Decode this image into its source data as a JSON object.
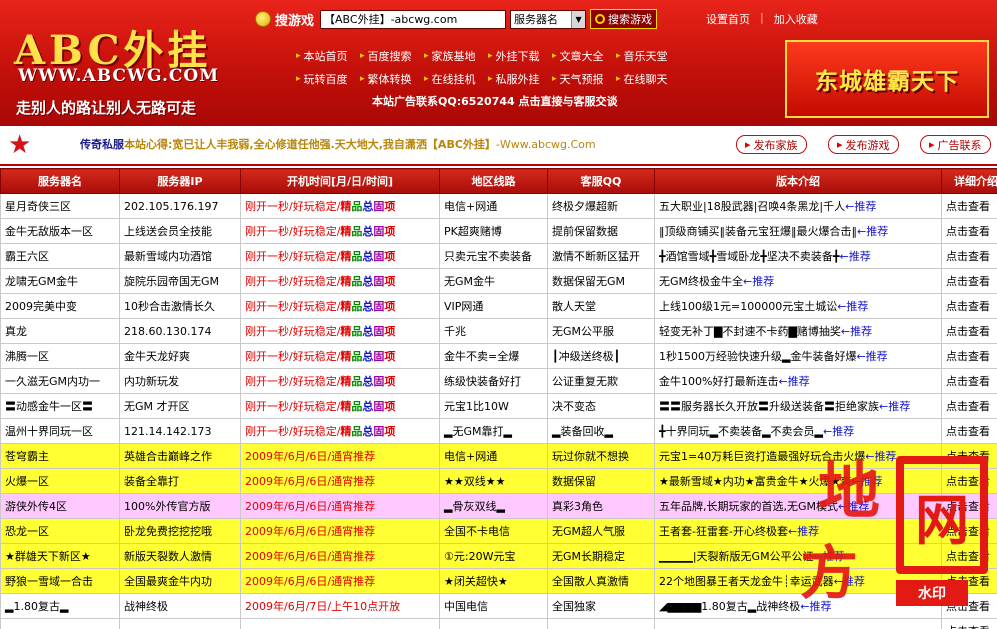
{
  "header": {
    "logo_title": "ABC外挂",
    "logo_url": "WWW.ABCWG.COM",
    "slogan": "走别人的路让别人无路可走",
    "search_label": "搜游戏",
    "search_value": "【ABC外挂】-abcwg.com",
    "select_value": "服务器名",
    "search_button": "搜索游戏",
    "top_links": [
      "设置首页",
      "加入收藏"
    ],
    "nav_rows": [
      [
        "本站首页",
        "百度搜索",
        "家族基地",
        "外挂下载",
        "文章大全",
        "音乐天堂"
      ],
      [
        "玩转百度",
        "繁体转换",
        "在线挂机",
        "私服外挂",
        "天气预报",
        "在线聊天"
      ]
    ],
    "ad_contact": "本站广告联系QQ:6520744 点击直接与客服交谈",
    "banner_text": "东城雄霸天下"
  },
  "announce": {
    "prefix": "传奇私服",
    "bold_text": "本站心得:宽已让人丰我弱,全心修道任他强.天大地大,我自潇洒【ABC外挂】",
    "url_text": "-Www.abcwg.Com",
    "buttons": [
      "发布家族",
      "发布游戏",
      "广告联系"
    ]
  },
  "columns": [
    "服务器名",
    "服务器IP",
    "开机时间[月/日/时间]",
    "地区线路",
    "客服QQ",
    "版本介绍",
    "详细介绍"
  ],
  "rows": [
    {
      "style": "",
      "name": "星月奇侠三区",
      "ip": "202.105.176.197",
      "time": "刚开一秒/好玩稳定/",
      "hot": true,
      "line": "电信+网通",
      "qq": "终极夕爆超新",
      "intro": "五大职业|18股武器|召唤4条黑龙|千人",
      "rec": "推荐",
      "detail": "点击查看"
    },
    {
      "style": "",
      "name": "金牛无敌版本一区",
      "ip": "上线送会员全技能",
      "time": "刚开一秒/好玩稳定/",
      "hot": true,
      "line": "PK超爽赌博",
      "qq": "提前保留数据",
      "intro": "‖顶级商铺买‖装备元宝狂爆‖最火爆合击‖",
      "rec": "推荐",
      "detail": "点击查看"
    },
    {
      "style": "",
      "name": "霸王六区",
      "ip": "最新雪域内功酒馆",
      "time": "刚开一秒/好玩稳定/",
      "hot": true,
      "line": "只卖元宝不卖装备",
      "qq": "激情不断新区猛开",
      "intro": "╋酒馆雪域╋雪域卧龙╋坚决不卖装备╋",
      "rec": "推荐",
      "detail": "点击查看"
    },
    {
      "style": "",
      "name": "龙啸无GM金牛",
      "ip": "旋院乐园帝国无GM",
      "time": "刚开一秒/好玩稳定/",
      "hot": true,
      "line": "无GM金牛",
      "qq": "数据保留无GM",
      "intro": "无GM终极金牛全",
      "rec": "推荐",
      "detail": "点击查看"
    },
    {
      "style": "",
      "name": "2009完美中变",
      "ip": "10秒合击激情长久",
      "time": "刚开一秒/好玩稳定/",
      "hot": true,
      "line": "VIP网通",
      "qq": "散人天堂",
      "intro": "上线100级1元=100000元宝土城讼",
      "rec": "推荐",
      "detail": "点击查看"
    },
    {
      "style": "",
      "name": "真龙",
      "ip": "218.60.130.174",
      "time": "刚开一秒/好玩稳定/",
      "hot": true,
      "line": "千兆",
      "qq": "无GM公平服",
      "intro": "轻变无补丁▇不封速不卡药▇赌博抽奖",
      "rec": "推荐",
      "detail": "点击查看"
    },
    {
      "style": "",
      "name": "沸腾一区",
      "ip": "金牛天龙好爽",
      "time": "刚开一秒/好玩稳定/",
      "hot": true,
      "line": "金牛不卖=全爆",
      "qq": "┃冲级送终极┃",
      "intro": "1秒1500万经验快速升级▂金牛装备好爆",
      "rec": "推荐",
      "detail": "点击查看"
    },
    {
      "style": "",
      "name": "一久滋无GM内功一",
      "ip": "内功新玩发",
      "time": "刚开一秒/好玩稳定/",
      "hot": true,
      "line": "练级快装备好打",
      "qq": "公证重复无欺",
      "intro": "金牛100%好打最新连击",
      "rec": "推荐",
      "detail": "点击查看"
    },
    {
      "style": "",
      "name": "〓动感金牛一区〓",
      "ip": "无GM 才开区",
      "time": "刚开一秒/好玩稳定/",
      "hot": true,
      "line": "元宝1比10W",
      "qq": "决不变态",
      "intro": "〓〓服务器长久开放〓升级送装备〓拒绝家族",
      "rec": "推荐",
      "detail": "点击查看"
    },
    {
      "style": "",
      "name": "温州十界同玩一区",
      "ip": "121.14.142.173",
      "time": "刚开一秒/好玩稳定/",
      "hot": true,
      "line": "▂无GM靠打▂",
      "qq": "▂装备回收▂",
      "intro": "╋十界同玩▂不卖装备▂不卖会员▂",
      "rec": "推荐",
      "detail": "点击查看"
    },
    {
      "style": "yellow",
      "name": "苍穹霸主",
      "ip": "英雄合击巅峰之作",
      "time": "2009年/6月/6日/通宵推荐",
      "hot": false,
      "line": "电信+网通",
      "qq": "玩过你就不想换",
      "intro": "元宝1=40万耗巨资打造最强好玩合击火爆",
      "rec": "推荐",
      "detail": "点击查看"
    },
    {
      "style": "yellow",
      "name": "火爆一区",
      "ip": "装备全靠打",
      "time": "2009年/6月/6日/通宵推荐",
      "hot": false,
      "line": "★★双线★★",
      "qq": "数据保留",
      "intro": "★最新雪域★内功★富贵金牛★火爆★爽",
      "rec": "推荐",
      "detail": "点击查看"
    },
    {
      "style": "pink",
      "name": "游侠外传4区",
      "ip": "100%外传官方版",
      "time": "2009年/6月/6日/通宵推荐",
      "hot": false,
      "line": "▂骨灰双线▂",
      "qq": "真彩3角色",
      "intro": "五年品牌,长期玩家的首选,无GM模式",
      "rec": "推荐",
      "detail": "点击查看"
    },
    {
      "style": "yellow",
      "name": "恐龙一区",
      "ip": "卧龙免费挖挖挖哦",
      "time": "2009年/6月/6日/通宵推荐",
      "hot": false,
      "line": "全国不卡电信",
      "qq": "无GM超人气服",
      "intro": "王者套-狂雷套-开心终极套",
      "rec": "推荐",
      "detail": "点击查看"
    },
    {
      "style": "yellow",
      "name": "★群雄天下新区★",
      "ip": "新版天裂数人激情",
      "time": "2009年/6月/6日/通宵推荐",
      "hot": false,
      "line": "①元:20W元宝",
      "qq": "无GM长期稳定",
      "intro": "▁▁▁▁|天裂新版无GM公平公证",
      "rec": "推荐",
      "detail": "点击查看"
    },
    {
      "style": "yellow",
      "name": "野狼一雪域一合击",
      "ip": "全国最爽金牛内功",
      "time": "2009年/6月/6日/通宵推荐",
      "hot": false,
      "line": "★闭关超快★",
      "qq": "全国散人真激情",
      "intro": "22个地图暴王者天龙金牛┊幸运武器",
      "rec": "推荐",
      "detail": "点击查看"
    },
    {
      "style": "",
      "name": "▂1.80复古▂",
      "ip": "战神终极",
      "time": "2009年/6月/7日/上午10点开放",
      "hot": false,
      "line": "中国电信",
      "qq": "全国独家",
      "intro": "◢▆▆▆▆1.80复古▂战神终极",
      "rec": "推荐",
      "detail": "点击查看"
    },
    {
      "style": "",
      "name": "▂▂▂▂",
      "ip": "▂▂▂",
      "time": "▂▂▂▂▂",
      "hot": false,
      "line": "▂▂",
      "qq": "▂▂",
      "intro": "▂▂▂▂",
      "rec": "",
      "detail": "点击查看"
    }
  ],
  "hot_label": [
    "精",
    "品",
    "总",
    "固",
    "项"
  ],
  "watermark": {
    "char1": "地",
    "char2": "方",
    "box_char": "网",
    "tag": "水印"
  }
}
